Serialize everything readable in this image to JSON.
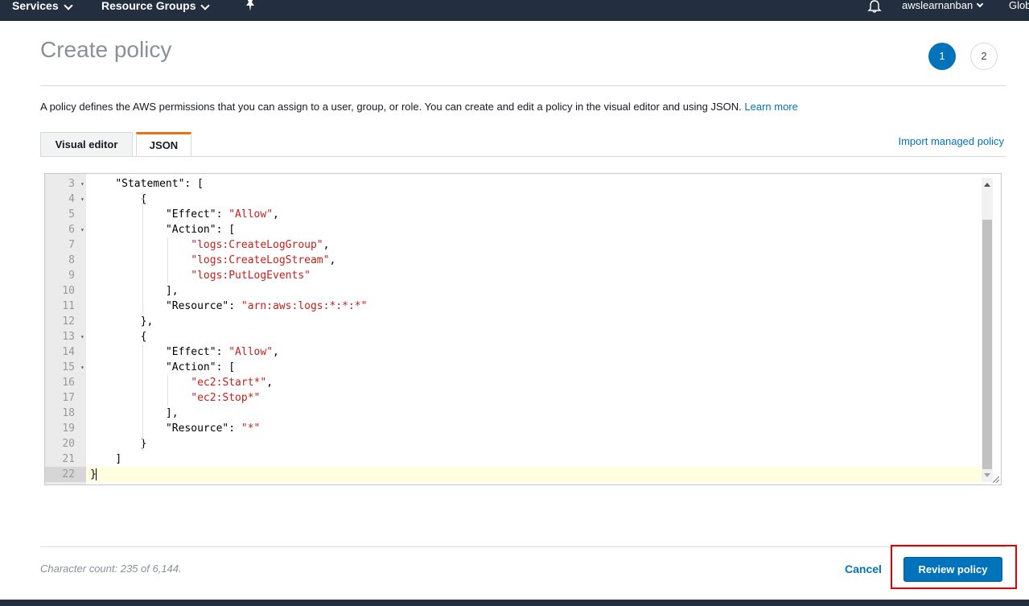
{
  "nav": {
    "services": "Services",
    "resource_groups": "Resource Groups",
    "user": "awslearnanban",
    "region": "Glob"
  },
  "page": {
    "title": "Create policy",
    "steps": [
      "1",
      "2"
    ],
    "intro": "A policy defines the AWS permissions that you can assign to a user, group, or role. You can create and edit a policy in the visual editor and using JSON.",
    "learn_more": "Learn more"
  },
  "tabs": {
    "visual_editor": "Visual editor",
    "json": "JSON",
    "import_link": "Import managed policy"
  },
  "editor": {
    "lines": [
      {
        "n": "3",
        "fold": true,
        "indent": 1,
        "parts": [
          {
            "t": "\"Statement\": ["
          }
        ]
      },
      {
        "n": "4",
        "fold": true,
        "indent": 2,
        "parts": [
          {
            "t": "{"
          }
        ]
      },
      {
        "n": "5",
        "fold": false,
        "indent": 3,
        "parts": [
          {
            "t": "\"Effect\": "
          },
          {
            "t": "\"Allow\"",
            "s": true
          },
          {
            "t": ","
          }
        ]
      },
      {
        "n": "6",
        "fold": true,
        "indent": 3,
        "parts": [
          {
            "t": "\"Action\": ["
          }
        ]
      },
      {
        "n": "7",
        "fold": false,
        "indent": 4,
        "parts": [
          {
            "t": "\"logs:CreateLogGroup\"",
            "s": true
          },
          {
            "t": ","
          }
        ]
      },
      {
        "n": "8",
        "fold": false,
        "indent": 4,
        "parts": [
          {
            "t": "\"logs:CreateLogStream\"",
            "s": true
          },
          {
            "t": ","
          }
        ]
      },
      {
        "n": "9",
        "fold": false,
        "indent": 4,
        "parts": [
          {
            "t": "\"logs:PutLogEvents\"",
            "s": true
          }
        ]
      },
      {
        "n": "10",
        "fold": false,
        "indent": 3,
        "parts": [
          {
            "t": "],"
          }
        ]
      },
      {
        "n": "11",
        "fold": false,
        "indent": 3,
        "parts": [
          {
            "t": "\"Resource\": "
          },
          {
            "t": "\"arn:aws:logs:*:*:*\"",
            "s": true
          }
        ]
      },
      {
        "n": "12",
        "fold": false,
        "indent": 2,
        "parts": [
          {
            "t": "},"
          }
        ]
      },
      {
        "n": "13",
        "fold": true,
        "indent": 2,
        "parts": [
          {
            "t": "{"
          }
        ]
      },
      {
        "n": "14",
        "fold": false,
        "indent": 3,
        "parts": [
          {
            "t": "\"Effect\": "
          },
          {
            "t": "\"Allow\"",
            "s": true
          },
          {
            "t": ","
          }
        ]
      },
      {
        "n": "15",
        "fold": true,
        "indent": 3,
        "parts": [
          {
            "t": "\"Action\": ["
          }
        ]
      },
      {
        "n": "16",
        "fold": false,
        "indent": 4,
        "parts": [
          {
            "t": "\"ec2:Start*\"",
            "s": true
          },
          {
            "t": ","
          }
        ]
      },
      {
        "n": "17",
        "fold": false,
        "indent": 4,
        "parts": [
          {
            "t": "\"ec2:Stop*\"",
            "s": true
          }
        ]
      },
      {
        "n": "18",
        "fold": false,
        "indent": 3,
        "parts": [
          {
            "t": "],"
          }
        ]
      },
      {
        "n": "19",
        "fold": false,
        "indent": 3,
        "parts": [
          {
            "t": "\"Resource\": "
          },
          {
            "t": "\"*\"",
            "s": true
          }
        ]
      },
      {
        "n": "20",
        "fold": false,
        "indent": 2,
        "parts": [
          {
            "t": "}"
          }
        ]
      },
      {
        "n": "21",
        "fold": false,
        "indent": 1,
        "parts": [
          {
            "t": "]"
          }
        ]
      },
      {
        "n": "22",
        "fold": false,
        "indent": 0,
        "current": true,
        "parts": [
          {
            "t": "}"
          }
        ]
      }
    ]
  },
  "footer": {
    "character_count": "Character count: 235 of 6,144.",
    "cancel": "Cancel",
    "review": "Review policy"
  },
  "colors": {
    "nav_bg": "#232f3e",
    "primary": "#0073bb",
    "tab_accent": "#ec7211",
    "json_string": "#c4201c",
    "highlight_box": "#e00000"
  }
}
